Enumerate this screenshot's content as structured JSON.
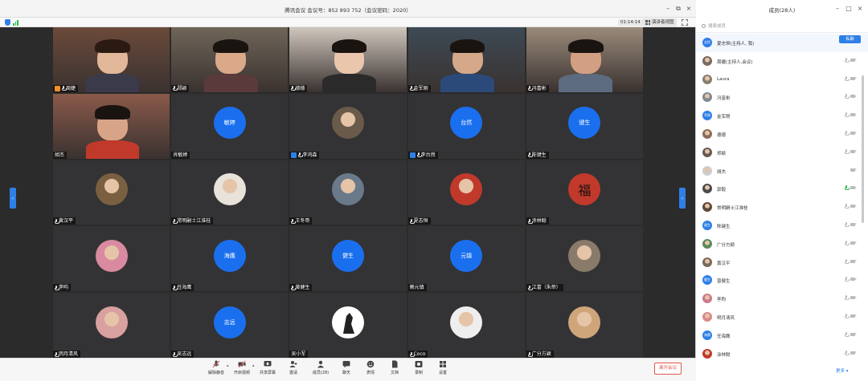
{
  "meeting": {
    "title": "腾讯会议  会议号：852 893 752（会议密码：2020）",
    "timer": "01:14:14",
    "gallery_label": "演讲者视图",
    "top_banner_fragment": "江坤武晶",
    "tiles": [
      {
        "name": "周婕",
        "kind": "video",
        "badge": "host"
      },
      {
        "name": "郑颖",
        "kind": "video"
      },
      {
        "name": "德德",
        "kind": "video"
      },
      {
        "name": "金军刚",
        "kind": "video"
      },
      {
        "name": "冯富彬",
        "kind": "video"
      },
      {
        "name": "胡杰",
        "kind": "video",
        "nomic": true
      },
      {
        "name": "肖敏婷",
        "kind": "circle",
        "circle_text": "敏婷",
        "nomic": true
      },
      {
        "name": "李鸿森",
        "kind": "photo",
        "badge": "cohost"
      },
      {
        "name": "李台然",
        "kind": "circle",
        "circle_text": "台然",
        "badge": "cohost"
      },
      {
        "name": "陈键生",
        "kind": "circle",
        "circle_text": "键生"
      },
      {
        "name": "黄汉平",
        "kind": "photo"
      },
      {
        "name": "常明嗣士江淮桂",
        "kind": "photo"
      },
      {
        "name": "王冬哥",
        "kind": "photo"
      },
      {
        "name": "夏志恒",
        "kind": "photo"
      },
      {
        "name": "涂林聪",
        "kind": "fu",
        "circle_text": "福"
      },
      {
        "name": "李昀",
        "kind": "photo"
      },
      {
        "name": "任海鹰",
        "kind": "circle",
        "circle_text": "海鹰"
      },
      {
        "name": "黄健生",
        "kind": "circle",
        "circle_text": "健生"
      },
      {
        "name": "赖元镇",
        "kind": "circle",
        "circle_text": "元镇",
        "nomic": true
      },
      {
        "name": "江富（朱帝）",
        "kind": "photo"
      },
      {
        "name": "明月清风",
        "kind": "photo"
      },
      {
        "name": "吴志远",
        "kind": "circle",
        "circle_text": "志远"
      },
      {
        "name": "吴小军",
        "kind": "wolf",
        "nomic": true
      },
      {
        "name": "Coco",
        "kind": "photo"
      },
      {
        "name": "广分方颖",
        "kind": "photo"
      }
    ],
    "toolbar": [
      {
        "label": "解除静音",
        "icon": "mic-icon"
      },
      {
        "label": "开启视频",
        "icon": "video-icon"
      },
      {
        "label": "共享屏幕",
        "icon": "share-screen-icon"
      },
      {
        "label": "邀请",
        "icon": "invite-icon"
      },
      {
        "label": "成员(28)",
        "icon": "members-icon"
      },
      {
        "label": "聊天",
        "icon": "chat-icon"
      },
      {
        "label": "表情",
        "icon": "emoji-icon"
      },
      {
        "label": "文档",
        "icon": "document-icon"
      },
      {
        "label": "录制",
        "icon": "record-icon"
      },
      {
        "label": "设置",
        "icon": "settings-icon"
      }
    ],
    "leave_label": "离开会议"
  },
  "panel": {
    "title": "成员(28人)",
    "search_placeholder": "搜索成员",
    "mute_all_label": "私聊",
    "more_label": "更多",
    "members": [
      {
        "name": "夏志恒(主持人, 我)",
        "avatar_color": "#2f7fe8",
        "avatar_text": "志恒",
        "mic": "none",
        "me": true
      },
      {
        "name": "周婕(主持人,会议)",
        "avatar_color": "#7a6a60",
        "mic": "off"
      },
      {
        "name": "Laura",
        "avatar_color": "#8a7d70",
        "mic": "off"
      },
      {
        "name": "冯富彬",
        "avatar_color": "#7d8a95",
        "mic": "off"
      },
      {
        "name": "金军刚",
        "avatar_color": "#2f7fe8",
        "avatar_text": "军刚",
        "mic": "off"
      },
      {
        "name": "德德",
        "avatar_color": "#8a6d5c",
        "mic": "off"
      },
      {
        "name": "郑颖",
        "avatar_color": "#6a5a52",
        "mic": "off"
      },
      {
        "name": "胡杰",
        "avatar_color": "#cccccc",
        "mic": "none"
      },
      {
        "name": "郭毅",
        "avatar_color": "#4a4a4a",
        "mic": "on"
      },
      {
        "name": "常明嗣士江淮桂",
        "avatar_color": "#5c4a3a",
        "mic": "off"
      },
      {
        "name": "陈键生",
        "avatar_color": "#2f7fe8",
        "avatar_text": "键生",
        "mic": "off"
      },
      {
        "name": "广分方颖",
        "avatar_color": "#5a8a5a",
        "mic": "off"
      },
      {
        "name": "黄汉平",
        "avatar_color": "#7a6a5a",
        "mic": "off"
      },
      {
        "name": "曾健生",
        "avatar_color": "#2f7fe8",
        "avatar_text": "健生",
        "mic": "off"
      },
      {
        "name": "李昀",
        "avatar_color": "#c97a8a",
        "mic": "off"
      },
      {
        "name": "明月清风",
        "avatar_color": "#d98a8a",
        "mic": "off"
      },
      {
        "name": "任海鹰",
        "avatar_color": "#2f7fe8",
        "avatar_text": "海鹰",
        "mic": "off"
      },
      {
        "name": "涂林聪",
        "avatar_color": "#c0392b",
        "mic": "off"
      }
    ]
  }
}
